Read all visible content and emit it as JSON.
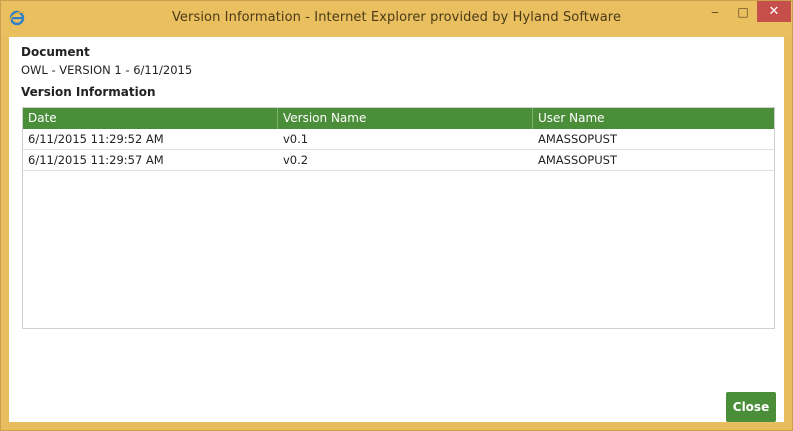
{
  "window": {
    "title": "Version Information - Internet Explorer provided by Hyland Software",
    "minimize_glyph": "‒",
    "maximize_glyph": "□",
    "close_glyph": "✕"
  },
  "document": {
    "heading": "Document",
    "value": "OWL - VERSION 1 - 6/11/2015"
  },
  "version_info": {
    "heading": "Version Information",
    "columns": [
      "Date",
      "Version Name",
      "User Name"
    ],
    "rows": [
      [
        "6/11/2015 11:29:52 AM",
        "v0.1",
        "AMASSOPUST"
      ],
      [
        "6/11/2015 11:29:57 AM",
        "v0.2",
        "AMASSOPUST"
      ]
    ]
  },
  "footer": {
    "close_label": "Close"
  },
  "colors": {
    "accent_green": "#4b8e3a",
    "titlebar": "#e9bf5f",
    "close_red": "#c74f4b"
  },
  "icons": {
    "app_icon": "internet-explorer-icon"
  }
}
